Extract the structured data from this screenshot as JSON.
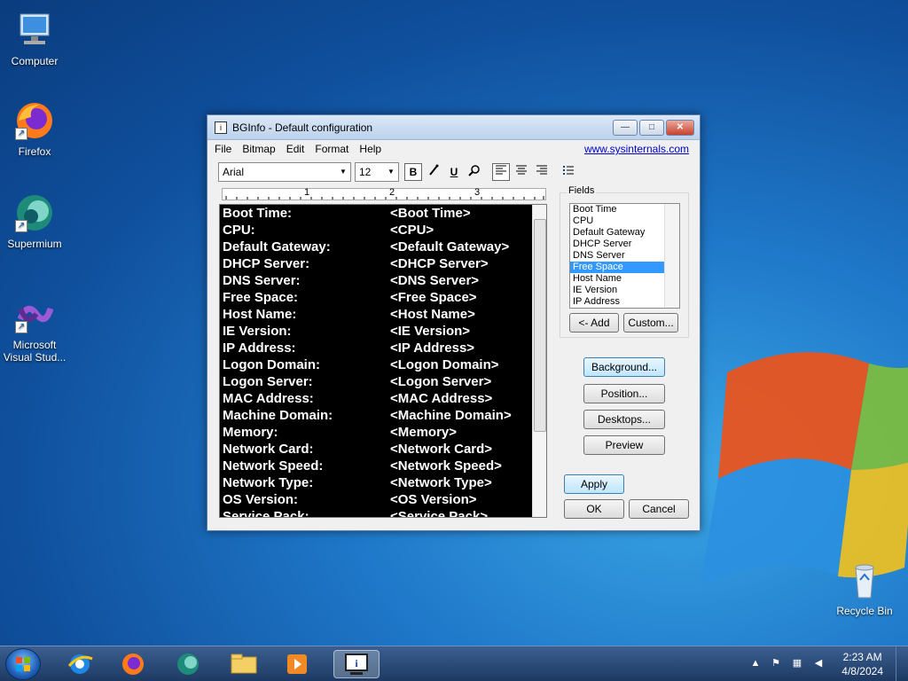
{
  "desktop": {
    "icons": [
      {
        "label": "Computer",
        "icon": "computer-icon"
      },
      {
        "label": "Firefox",
        "icon": "firefox-icon"
      },
      {
        "label": "Supermium",
        "icon": "supermium-icon"
      },
      {
        "label": "Microsoft Visual Stud...",
        "icon": "visual-studio-icon"
      },
      {
        "label": "Recycle Bin",
        "icon": "recycle-bin-icon"
      }
    ]
  },
  "window": {
    "title": "BGInfo - Default configuration",
    "menu": [
      "File",
      "Bitmap",
      "Edit",
      "Format",
      "Help"
    ],
    "link": "www.sysinternals.com",
    "font_name": "Arial",
    "font_size": "12",
    "toolbar_buttons": {
      "bold": "B",
      "underline": "U"
    },
    "ruler": [
      "1",
      "2",
      "3"
    ],
    "editor_rows": [
      {
        "label": "Boot Time:",
        "value": "<Boot Time>"
      },
      {
        "label": "CPU:",
        "value": "<CPU>"
      },
      {
        "label": "Default Gateway:",
        "value": "<Default Gateway>"
      },
      {
        "label": "DHCP Server:",
        "value": "<DHCP Server>"
      },
      {
        "label": "DNS Server:",
        "value": "<DNS Server>"
      },
      {
        "label": "Free Space:",
        "value": "<Free Space>"
      },
      {
        "label": "Host Name:",
        "value": "<Host Name>"
      },
      {
        "label": "IE Version:",
        "value": "<IE Version>"
      },
      {
        "label": "IP Address:",
        "value": "<IP Address>"
      },
      {
        "label": "Logon Domain:",
        "value": "<Logon Domain>"
      },
      {
        "label": "Logon Server:",
        "value": "<Logon Server>"
      },
      {
        "label": "MAC Address:",
        "value": "<MAC Address>"
      },
      {
        "label": "Machine Domain:",
        "value": "<Machine Domain>"
      },
      {
        "label": "Memory:",
        "value": "<Memory>"
      },
      {
        "label": "Network Card:",
        "value": "<Network Card>"
      },
      {
        "label": "Network Speed:",
        "value": "<Network Speed>"
      },
      {
        "label": "Network Type:",
        "value": "<Network Type>"
      },
      {
        "label": "OS Version:",
        "value": "<OS Version>"
      },
      {
        "label": "Service Pack:",
        "value": "<Service Pack>"
      }
    ],
    "fields_label": "Fields",
    "fields": [
      "Boot Time",
      "CPU",
      "Default Gateway",
      "DHCP Server",
      "DNS Server",
      "Free Space",
      "Host Name",
      "IE Version",
      "IP Address"
    ],
    "selected_field": "Free Space",
    "add_button": "<- Add",
    "custom_button": "Custom...",
    "background_button": "Background...",
    "position_button": "Position...",
    "desktops_button": "Desktops...",
    "preview_button": "Preview",
    "apply_button": "Apply",
    "ok_button": "OK",
    "cancel_button": "Cancel"
  },
  "taskbar": {
    "time": "2:23 AM",
    "date": "4/8/2024",
    "pinned": [
      "internet-explorer-icon",
      "firefox-icon",
      "supermium-icon",
      "file-explorer-icon",
      "media-player-icon",
      "bginfo-icon"
    ]
  }
}
